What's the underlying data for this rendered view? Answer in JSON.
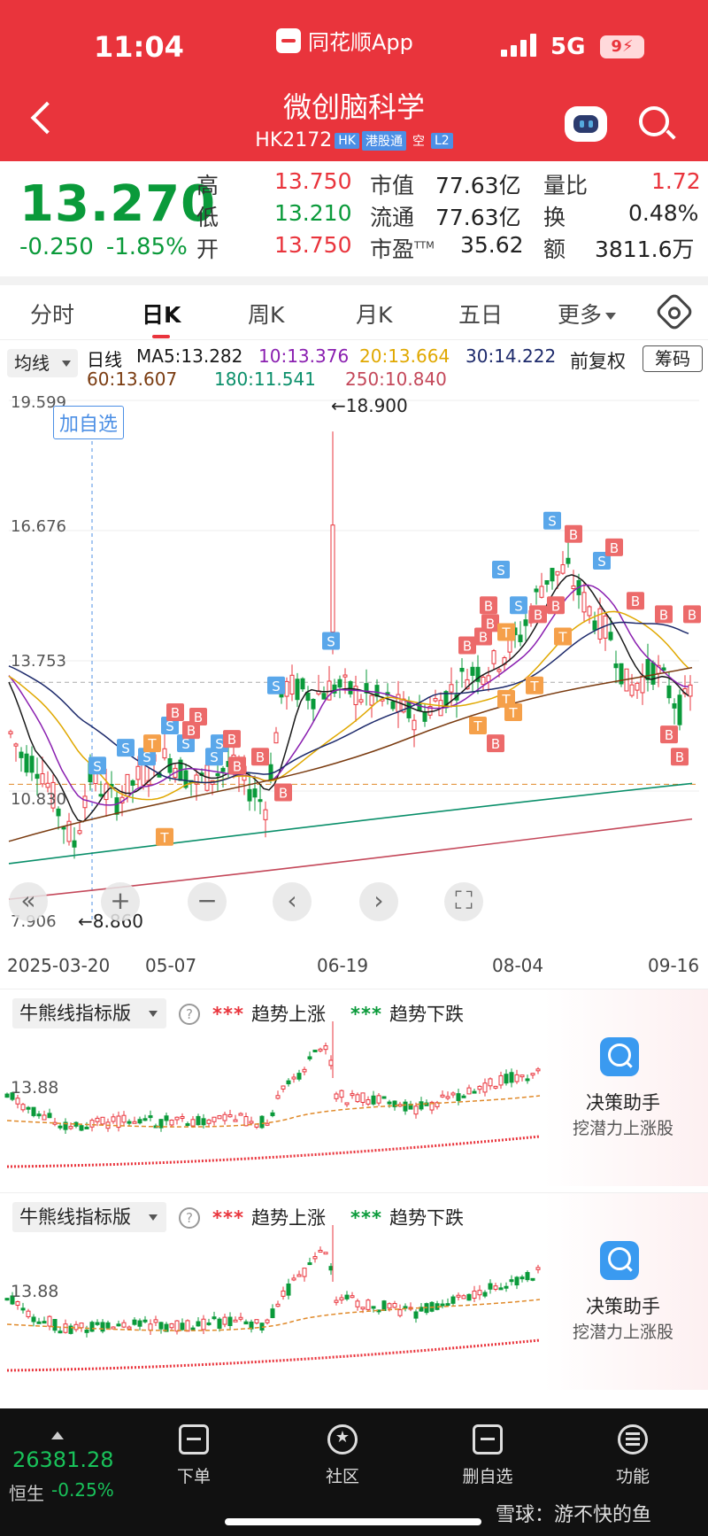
{
  "status_bar": {
    "time": "11:04",
    "source_app": "同花顺App",
    "network": "5G",
    "battery": "9"
  },
  "header": {
    "stock_name": "微创脑科学",
    "stock_code": "HK2172",
    "tags": [
      "HK",
      "港股通",
      "空",
      "L2"
    ]
  },
  "quote": {
    "last_price": "13.270",
    "change": "-0.250",
    "change_pct": "-1.85%",
    "high_label": "高",
    "high": "13.750",
    "low_label": "低",
    "low": "13.210",
    "open_label": "开",
    "open": "13.750",
    "mktcap_label": "市值",
    "mktcap": "77.63亿",
    "float_label": "流通",
    "float_cap": "77.63亿",
    "pe_label": "市盈",
    "pe_sup": "TTM",
    "pe": "35.62",
    "vol_ratio_label": "量比",
    "vol_ratio": "1.72",
    "turnover_label": "换",
    "turnover": "0.48%",
    "amount_label": "额",
    "amount": "3811.6万"
  },
  "tabs": [
    "分时",
    "日K",
    "周K",
    "月K",
    "五日",
    "更多"
  ],
  "active_tab": "日K",
  "ma_bar": {
    "selector": "均线",
    "period": "日线",
    "ma5": "MA5:13.282",
    "ma10": "10:13.376",
    "ma20": "20:13.664",
    "ma30": "30:14.222",
    "ma60": "60:13.607",
    "ma180": "180:11.541",
    "ma250": "250:10.840",
    "adjust": "前复权",
    "chips": "筹码"
  },
  "colors": {
    "up": "#e9343c",
    "down": "#0a9a3a",
    "ma5": "#1a1a1a",
    "ma10": "#8a1fb0",
    "ma20": "#e0a800",
    "ma30": "#1d2a6b",
    "ma60": "#7a3b10",
    "ma180": "#0a8f6a",
    "ma250": "#c4485a",
    "buy": "#ec6a6a",
    "sell": "#5aa7ea",
    "t": "#f5a04a"
  },
  "kchart": {
    "y_labels": [
      "19.599",
      "16.676",
      "13.753",
      "10.830",
      "7.906"
    ],
    "y_range": [
      7.906,
      19.599
    ],
    "high_annotation": "←18.900",
    "low_annotation": "←8.860",
    "add_watch": "加自选",
    "x_labels": [
      "2025-03-20",
      "05-07",
      "06-19",
      "08-04",
      "09-16"
    ],
    "dashed_prices": [
      13.27,
      10.83
    ],
    "markers": [
      {
        "t": "S",
        "x": 110,
        "p": 11.4
      },
      {
        "t": "S",
        "x": 142,
        "p": 11.8
      },
      {
        "t": "S",
        "x": 166,
        "p": 11.6
      },
      {
        "t": "T",
        "x": 172,
        "p": 11.9
      },
      {
        "t": "S",
        "x": 192,
        "p": 12.3
      },
      {
        "t": "B",
        "x": 198,
        "p": 12.6
      },
      {
        "t": "S",
        "x": 210,
        "p": 11.9
      },
      {
        "t": "B",
        "x": 216,
        "p": 12.2
      },
      {
        "t": "B",
        "x": 224,
        "p": 12.5
      },
      {
        "t": "S",
        "x": 242,
        "p": 11.6
      },
      {
        "t": "S",
        "x": 248,
        "p": 11.9
      },
      {
        "t": "B",
        "x": 262,
        "p": 12.0
      },
      {
        "t": "B",
        "x": 268,
        "p": 11.4
      },
      {
        "t": "B",
        "x": 294,
        "p": 11.6
      },
      {
        "t": "T",
        "x": 186,
        "p": 9.8
      },
      {
        "t": "S",
        "x": 312,
        "p": 13.2
      },
      {
        "t": "B",
        "x": 320,
        "p": 10.8
      },
      {
        "t": "S",
        "x": 374,
        "p": 14.2
      },
      {
        "t": "B",
        "x": 528,
        "p": 14.1
      },
      {
        "t": "B",
        "x": 546,
        "p": 14.3
      },
      {
        "t": "B",
        "x": 552,
        "p": 15.0
      },
      {
        "t": "B",
        "x": 554,
        "p": 14.6
      },
      {
        "t": "S",
        "x": 566,
        "p": 15.8
      },
      {
        "t": "S",
        "x": 586,
        "p": 15.0
      },
      {
        "t": "B",
        "x": 608,
        "p": 14.8
      },
      {
        "t": "B",
        "x": 628,
        "p": 15.0
      },
      {
        "t": "S",
        "x": 624,
        "p": 16.9
      },
      {
        "t": "B",
        "x": 648,
        "p": 16.6
      },
      {
        "t": "S",
        "x": 680,
        "p": 16.0
      },
      {
        "t": "B",
        "x": 694,
        "p": 16.3
      },
      {
        "t": "B",
        "x": 718,
        "p": 15.1
      },
      {
        "t": "B",
        "x": 750,
        "p": 14.8
      },
      {
        "t": "B",
        "x": 782,
        "p": 14.8
      },
      {
        "t": "T",
        "x": 572,
        "p": 14.4
      },
      {
        "t": "T",
        "x": 604,
        "p": 13.2
      },
      {
        "t": "T",
        "x": 636,
        "p": 14.3
      },
      {
        "t": "T",
        "x": 540,
        "p": 12.3
      },
      {
        "t": "T",
        "x": 572,
        "p": 12.9
      },
      {
        "t": "T",
        "x": 580,
        "p": 12.6
      },
      {
        "t": "B",
        "x": 560,
        "p": 11.9
      },
      {
        "t": "B",
        "x": 756,
        "p": 12.1
      },
      {
        "t": "B",
        "x": 768,
        "p": 11.6
      }
    ]
  },
  "indicator_panels": [
    {
      "selector": "牛熊线指标版",
      "legend_up": "趋势上涨",
      "legend_down": "趋势下跌",
      "y_label": "13.88",
      "assistant_title": "决策助手",
      "assistant_sub": "挖潜力上涨股"
    },
    {
      "selector": "牛熊线指标版",
      "legend_up": "趋势上涨",
      "legend_down": "趋势下跌",
      "y_label": "13.88",
      "assistant_title": "决策助手",
      "assistant_sub": "挖潜力上涨股"
    }
  ],
  "bottom_nav": {
    "index_value": "26381.28",
    "index_name": "恒生",
    "index_change": "-0.25%",
    "items": [
      "下单",
      "社区",
      "删自选",
      "功能"
    ],
    "watermark": "雪球：游不快的鱼"
  }
}
